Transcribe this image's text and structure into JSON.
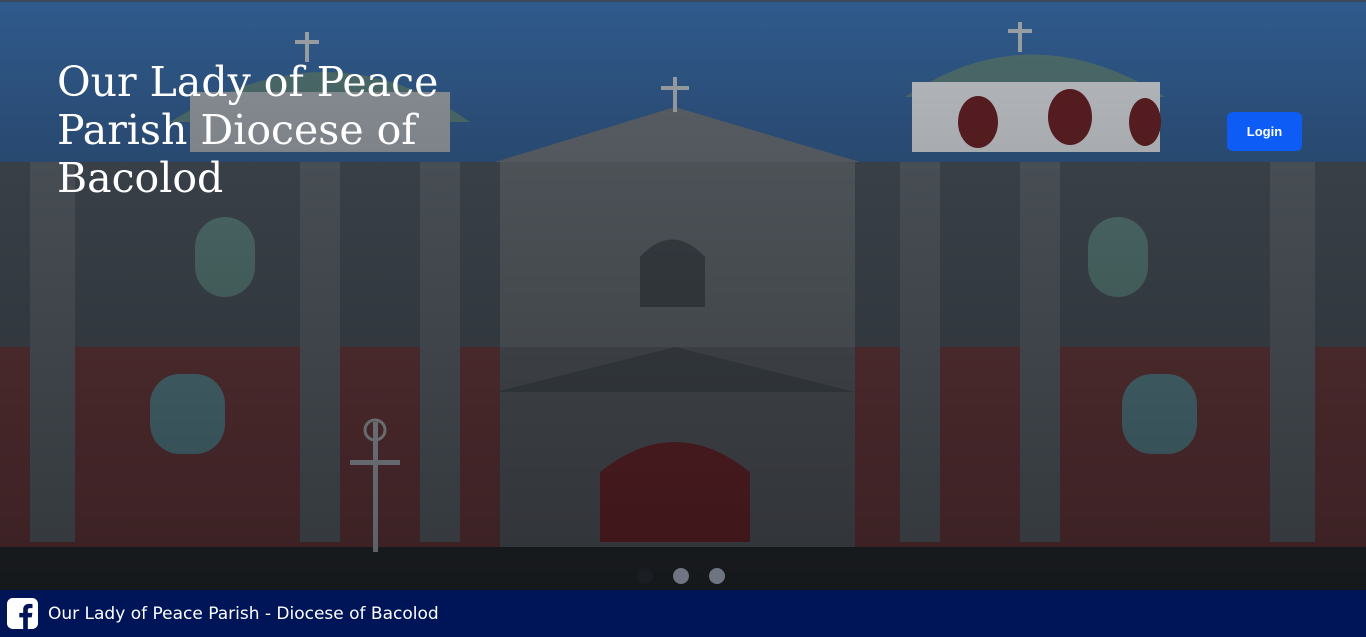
{
  "hero": {
    "title": "Our Lady of Peace Parish Diocese of Bacolod",
    "background_image": "church-facade-photo",
    "login_label": "Login",
    "carousel": {
      "slide_count": 3,
      "active_index": 0
    }
  },
  "footer": {
    "icon": "facebook-icon",
    "text": "Our Lady of Peace Parish - Diocese of Bacolod"
  },
  "colors": {
    "login_button": "#0d5cf5",
    "footer_bg": "#001558",
    "sky": "#2f5a8c"
  }
}
